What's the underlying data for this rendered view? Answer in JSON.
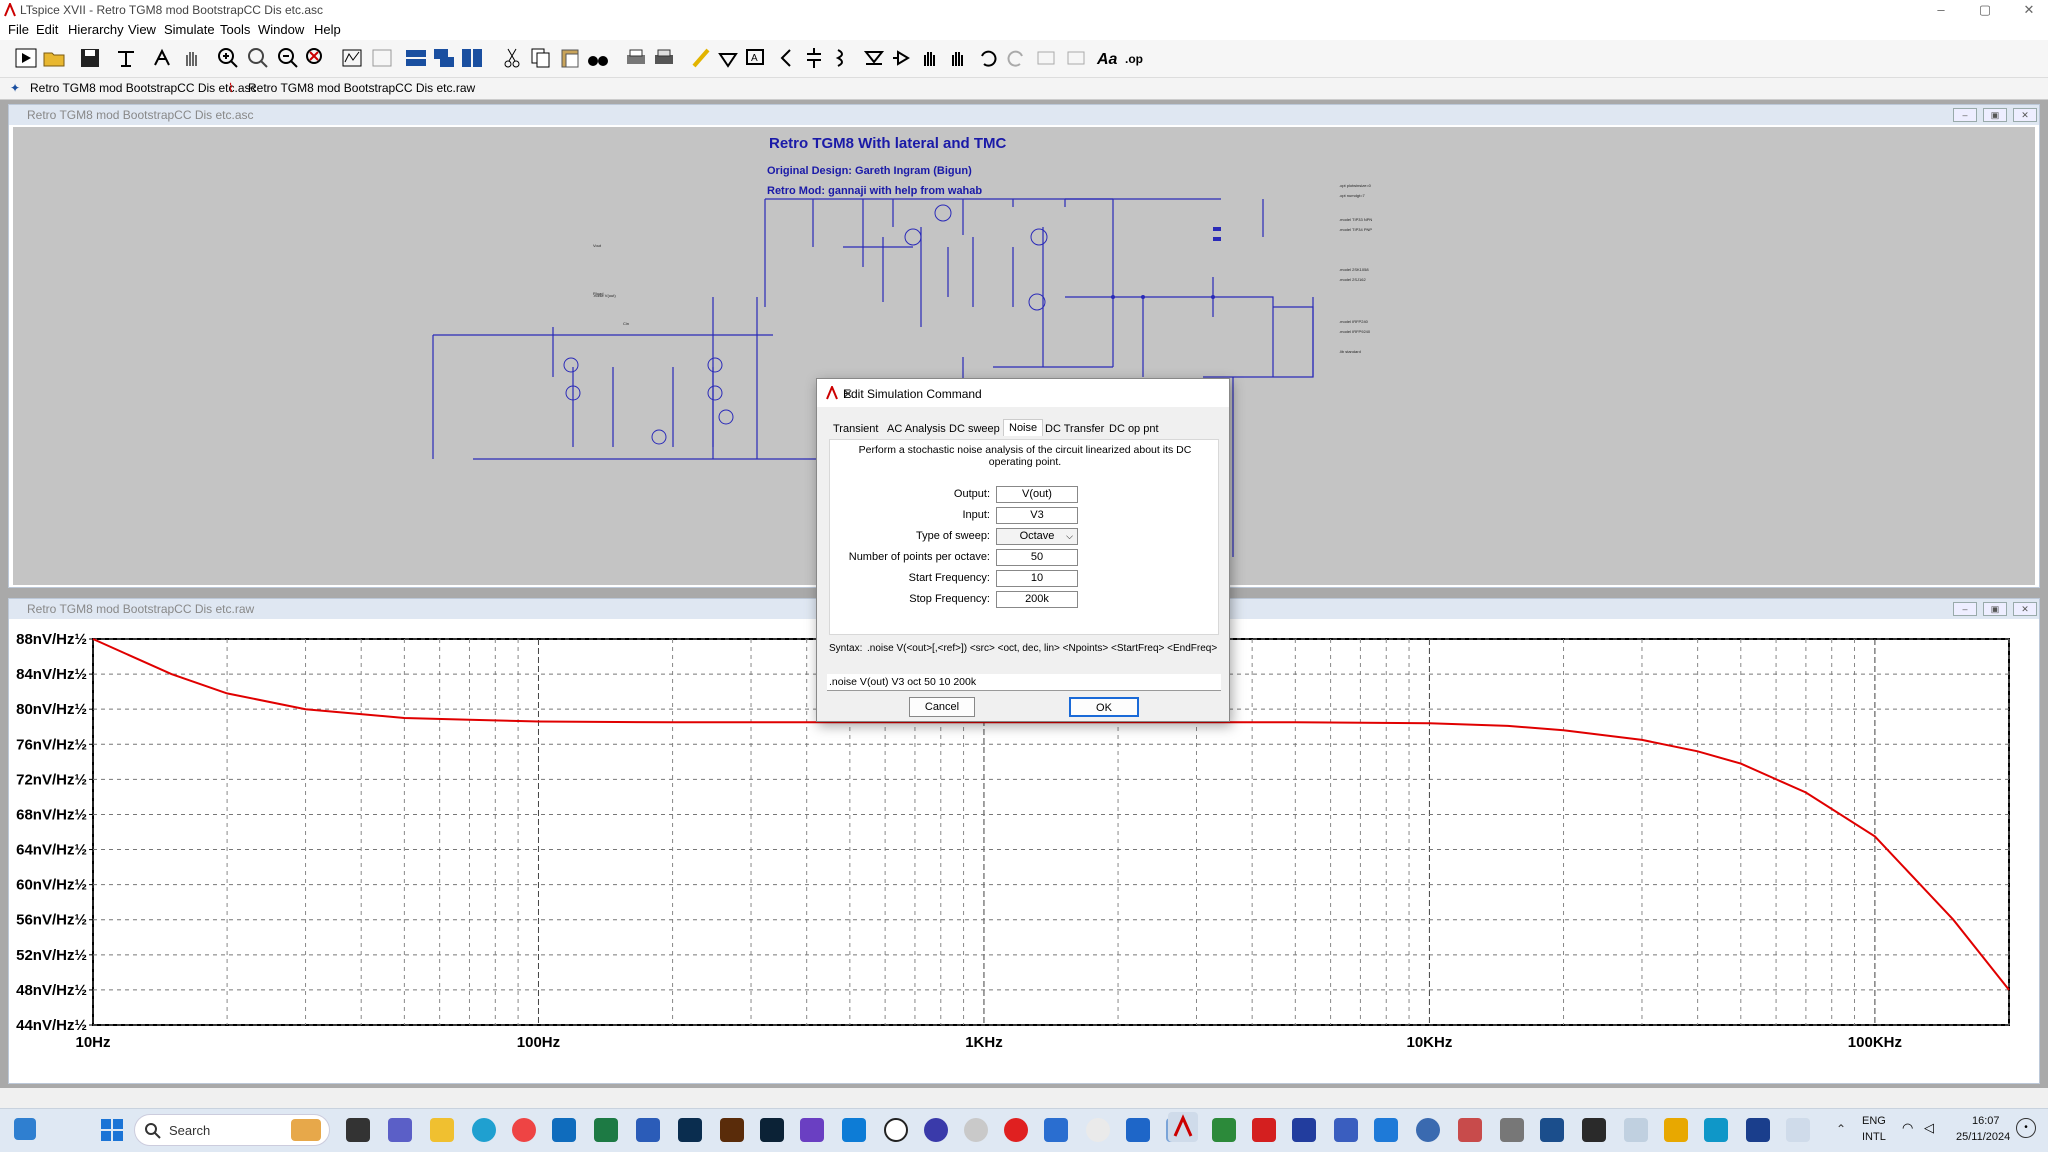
{
  "window": {
    "title": "LTspice XVII - Retro TGM8 mod BootstrapCC Dis etc.asc",
    "minimize": "–",
    "restore": "▢",
    "close": "✕"
  },
  "menu": [
    "File",
    "Edit",
    "Hierarchy",
    "View",
    "Simulate",
    "Tools",
    "Window",
    "Help"
  ],
  "tabs": [
    "Retro TGM8 mod BootstrapCC Dis etc.asc",
    "Retro TGM8 mod BootstrapCC Dis etc.raw"
  ],
  "schematic": {
    "window_title": "Retro TGM8 mod BootstrapCC Dis etc.asc",
    "title": "Retro TGM8 With lateral and TMC",
    "design_credit": "Original Design: Gareth Ingram (Bigun)",
    "mod_credit": "Retro Mod: gannaji with help from wahab"
  },
  "plot": {
    "window_title": "Retro TGM8 mod BootstrapCC Dis etc.raw",
    "trace_color": "#e00000"
  },
  "chart_data": {
    "type": "line",
    "x_scale": "log",
    "xlim": [
      10,
      200000
    ],
    "ylim": [
      44,
      88
    ],
    "x_ticks": [
      "10Hz",
      "100Hz",
      "1KHz",
      "10KHz",
      "100KHz"
    ],
    "y_ticks": [
      "88nV/Hz½",
      "84nV/Hz½",
      "80nV/Hz½",
      "76nV/Hz½",
      "72nV/Hz½",
      "68nV/Hz½",
      "64nV/Hz½",
      "60nV/Hz½",
      "56nV/Hz½",
      "52nV/Hz½",
      "48nV/Hz½",
      "44nV/Hz½"
    ],
    "y_tick_values": [
      88,
      84,
      80,
      76,
      72,
      68,
      64,
      60,
      56,
      52,
      48,
      44
    ],
    "x_tick_values": [
      10,
      100,
      1000,
      10000,
      100000
    ],
    "series": [
      {
        "x": [
          10,
          15,
          20,
          30,
          50,
          70,
          100,
          200,
          500,
          1000,
          2000,
          5000,
          10000,
          15000,
          20000,
          30000,
          40000,
          50000,
          70000,
          100000,
          150000,
          200000
        ],
        "y": [
          88,
          84,
          81.8,
          80,
          79,
          78.8,
          78.6,
          78.5,
          78.5,
          78.5,
          78.5,
          78.5,
          78.4,
          78.1,
          77.6,
          76.5,
          75.2,
          73.8,
          70.5,
          65.5,
          56.0,
          48.0
        ]
      }
    ],
    "grid": true
  },
  "dialog": {
    "title": "Edit Simulation Command",
    "close": "✕",
    "tabs": [
      "Transient",
      "AC Analysis",
      "DC sweep",
      "Noise",
      "DC Transfer",
      "DC op pnt"
    ],
    "active_tab": "Noise",
    "description": "Perform a stochastic noise analysis of the circuit linearized about its DC operating point.",
    "fields": [
      {
        "label": "Output:",
        "value": "V(out)"
      },
      {
        "label": "Input:",
        "value": "V3"
      },
      {
        "label": "Type of sweep:",
        "value": "Octave"
      },
      {
        "label": "Number of points per octave:",
        "value": "50"
      },
      {
        "label": "Start Frequency:",
        "value": "10"
      },
      {
        "label": "Stop Frequency:",
        "value": "200k"
      }
    ],
    "syntax_label": "Syntax:",
    "syntax": ".noise V(<out>[,<ref>]) <src> <oct, dec, lin> <Npoints> <StartFreq> <EndFreq>",
    "command": ".noise V(out) V3 oct 50 10 200k",
    "cancel": "Cancel",
    "ok": "OK"
  },
  "taskbar": {
    "search": "Search",
    "lang": "ENG",
    "layout": "INTL",
    "time": "16:07",
    "date": "25/11/2024"
  }
}
